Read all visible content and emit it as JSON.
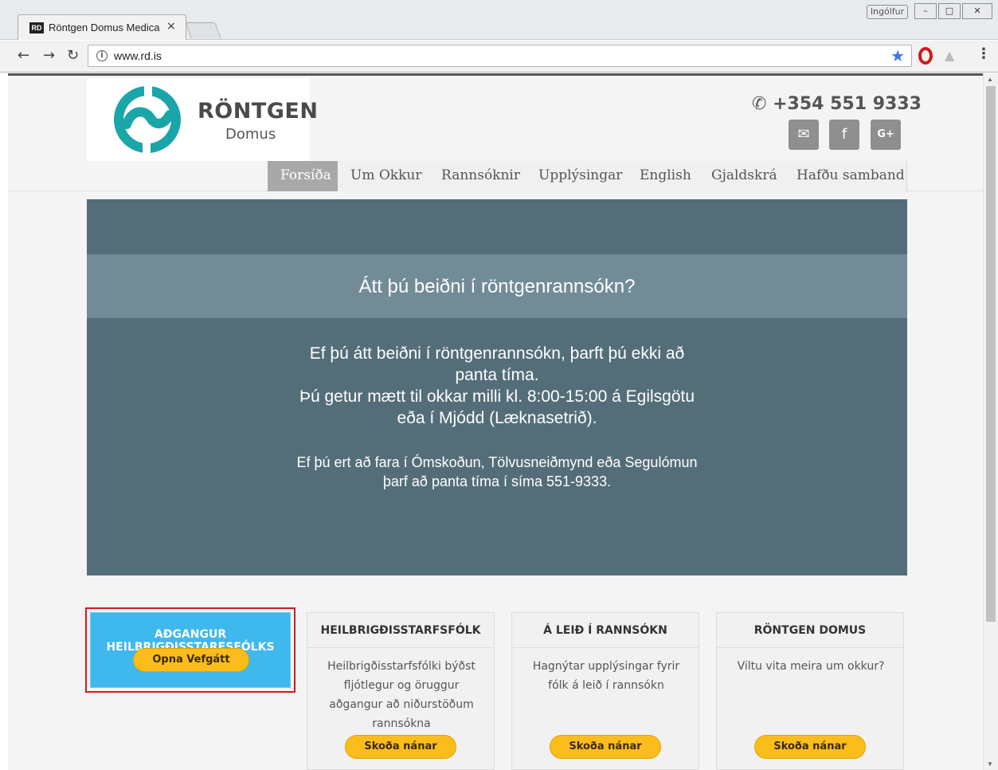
{
  "browser": {
    "tab_title": "Röntgen Domus Medica",
    "tab_favicon": "RD",
    "tab_close": "×",
    "profile_name": "Ingólfur",
    "url": "www.rd.is",
    "icons": [
      "back-icon",
      "forward-icon",
      "reload-icon",
      "info-icon",
      "star-icon",
      "opera-icon",
      "drive-icon",
      "menu-icon"
    ]
  },
  "site": {
    "logo_name": "RÖNTGEN",
    "logo_sub": "Domus",
    "phone": "+354 551 9333",
    "social": [
      "email-icon",
      "facebook-icon",
      "google-plus-icon"
    ],
    "nav": [
      {
        "label": "Forsíða",
        "active": true
      },
      {
        "label": "Um Okkur"
      },
      {
        "label": "Rannsóknir"
      },
      {
        "label": "Upplýsingar"
      },
      {
        "label": "English"
      },
      {
        "label": "Gjaldskrá"
      },
      {
        "label": "Hafðu samband"
      }
    ]
  },
  "hero": {
    "title": "Átt þú beiðni í röntgenrannsókn?",
    "p1_line1": "Ef þú átt beiðni í röntgenrannsókn, þarft þú ekki að",
    "p1_line2": "panta tíma.",
    "p1_line3": "Þú getur mætt til okkar milli kl. 8:00-15:00 á Egilsgötu",
    "p1_line4": "eða í Mjódd (Læknasetrið).",
    "p2_line1": "Ef þú ert að fara í Ómskoðun, Tölvusneiðmynd eða Segulómun",
    "p2_line2": "þarf að panta tíma í síma 551-9333."
  },
  "feature": {
    "title_line1": "AÐGANGUR",
    "title_line2": "HEILBRIGÐISSTARFSFÓLKS",
    "button": "Opna Vefgátt",
    "accent": "#3fb8ee"
  },
  "cards": [
    {
      "title": "HEILBRIGÐISSTARFSFÓLK",
      "text": "Heilbrigðisstarfsfólki býðst fljótlegur og öruggur aðgangur að niðurstöðum rannsókna",
      "button": "Skoða nánar"
    },
    {
      "title": "Á LEIÐ Í RANNSÓKN",
      "text": "Hagnýtar upplýsingar fyrir fólk á leið í rannsókn",
      "button": "Skoða nánar"
    },
    {
      "title": "RÖNTGEN DOMUS",
      "text": "Viltu vita meira um okkur?",
      "button": "Skoða nánar"
    }
  ],
  "colors": {
    "hero_bg": "#546e79",
    "hero_band": "#728c97",
    "button_yellow": "#fbbd1b",
    "logo_teal": "#1aa6a8"
  }
}
